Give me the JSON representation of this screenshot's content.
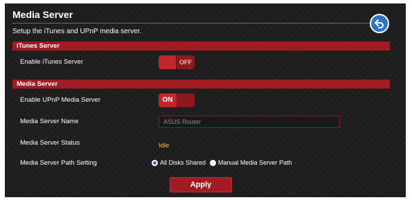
{
  "page": {
    "title": "Media Server",
    "subtitle": "Setup the iTunes and UPnP media server."
  },
  "itunes": {
    "section_title": "iTunes Server",
    "enable_label": "Enable iTunes Server",
    "toggle_text": "OFF",
    "enabled": false
  },
  "media": {
    "section_title": "Media Server",
    "enable_label": "Enable UPnP Media Server",
    "toggle_text": "ON",
    "enabled": true,
    "name_label": "Media Server Name",
    "name_value": "ASUS Router",
    "status_label": "Media Server Status",
    "status_value": "Idle",
    "path_label": "Media Server Path Setting",
    "path_options": [
      "All Disks Shared",
      "Manual Media Server Path"
    ],
    "path_selected": "All Disks Shared"
  },
  "actions": {
    "apply_label": "Apply"
  },
  "colors": {
    "panel_bg": "#1d1d1d",
    "section_bar": "#a01c22",
    "status_text": "#f3c02b",
    "back_button": "#2f73c6"
  },
  "icons": {
    "back": "back-arrow-icon"
  }
}
